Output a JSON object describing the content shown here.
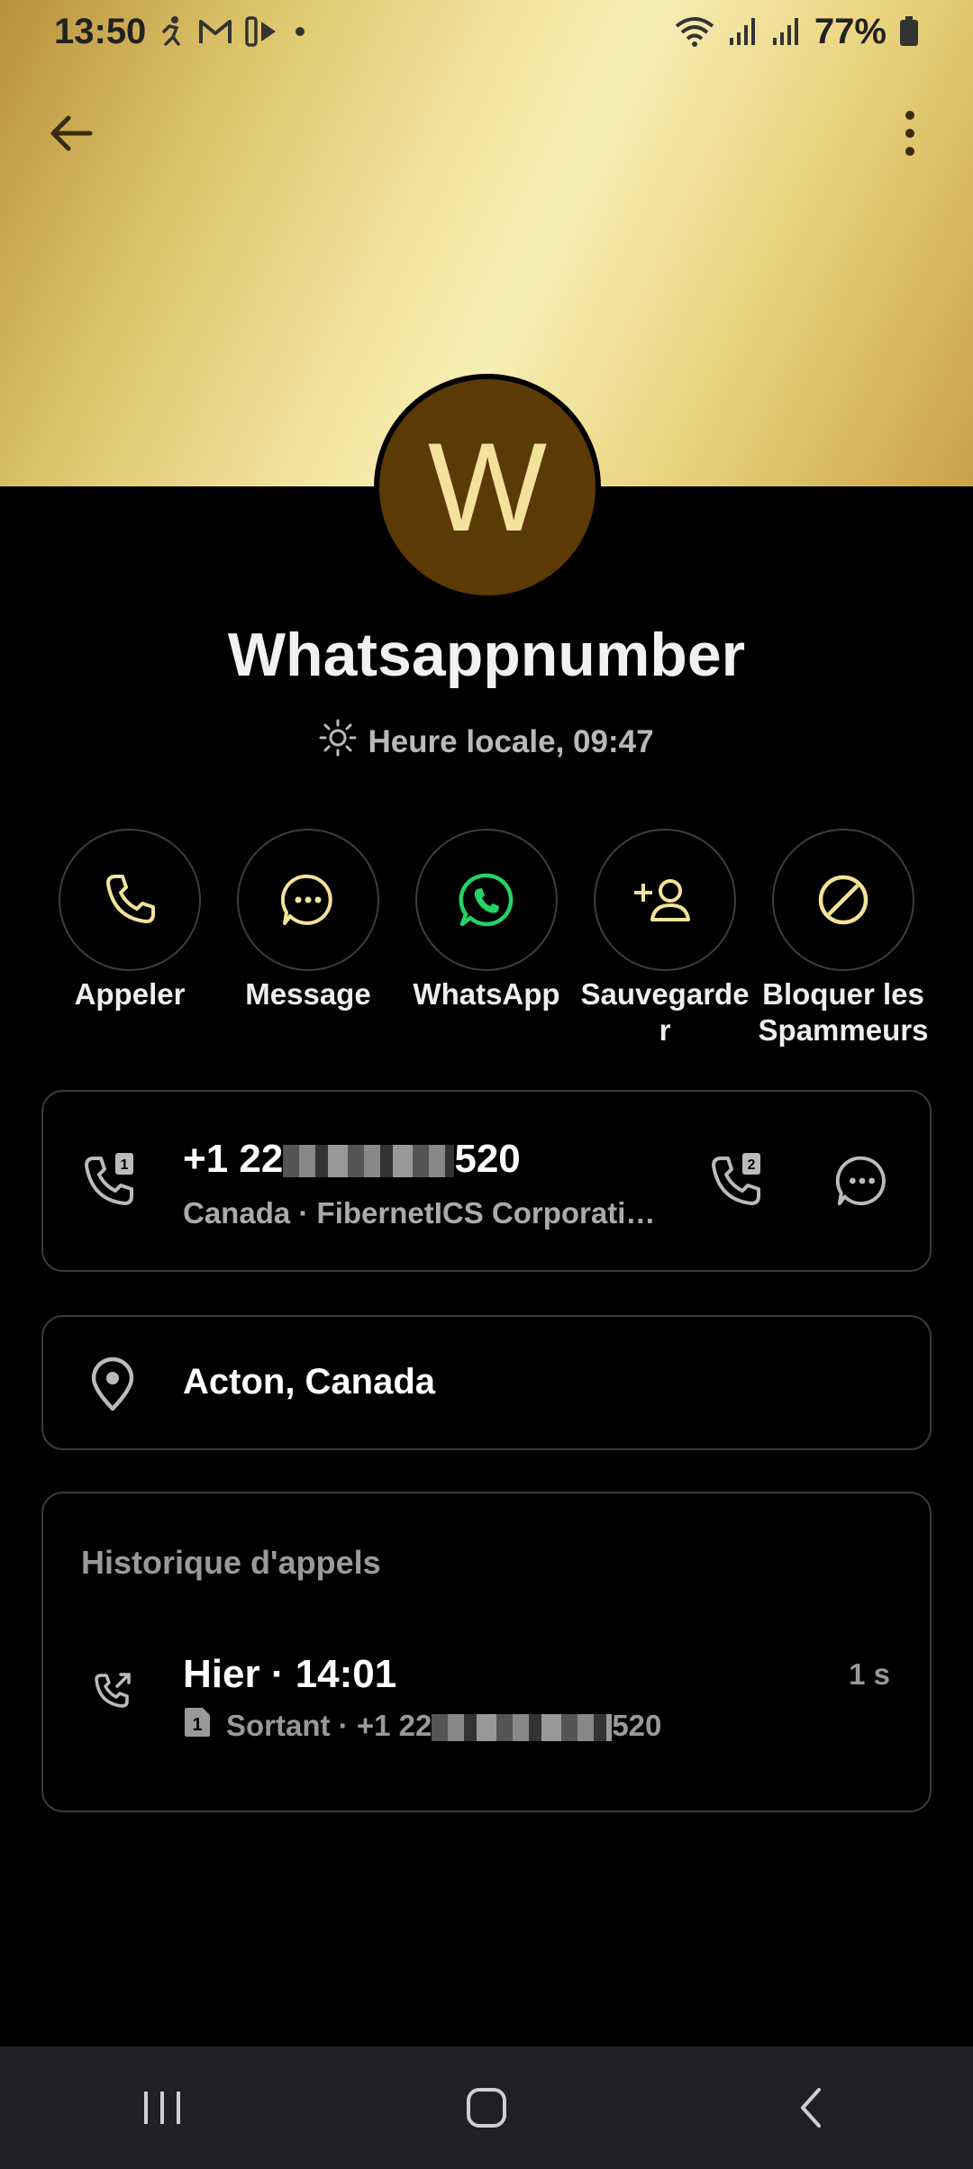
{
  "status_bar": {
    "time": "13:50",
    "battery": "77%"
  },
  "contact": {
    "initial": "W",
    "name": "Whatsappnumber",
    "local_time": "Heure locale, 09:47"
  },
  "actions": [
    {
      "label": "Appeler",
      "icon": "phone-icon"
    },
    {
      "label": "Message",
      "icon": "message-icon"
    },
    {
      "label": "WhatsApp",
      "icon": "whatsapp-icon"
    },
    {
      "label": "Sauvegarde\nr",
      "icon": "add-contact-icon"
    },
    {
      "label": "Bloquer les\nSpammeurs",
      "icon": "block-icon"
    }
  ],
  "phone": {
    "prefix": "+1 22",
    "suffix": "520",
    "detail": "Canada · FibernetICS Corporati…"
  },
  "location": {
    "text": "Acton, Canada"
  },
  "history": {
    "title": "Historique d'appels",
    "entries": [
      {
        "when": "Hier · 14:01",
        "direction_prefix": "Sortant · +1 22",
        "direction_suffix": "520",
        "duration": "1 s"
      }
    ]
  },
  "colors": {
    "accent": "#f3e39a",
    "whatsapp": "#25d366",
    "avatar_bg": "#5c3a06"
  }
}
